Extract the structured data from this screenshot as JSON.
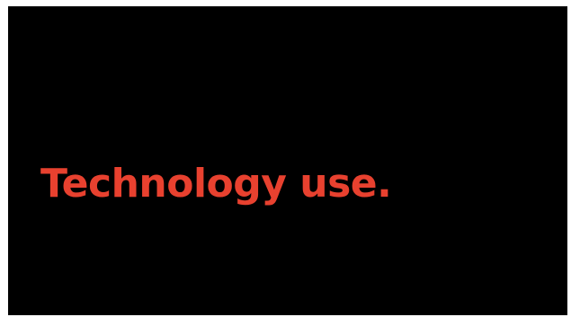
{
  "slide": {
    "title": "Technology use.",
    "background_color": "#000000",
    "title_color": "#e8412f"
  }
}
